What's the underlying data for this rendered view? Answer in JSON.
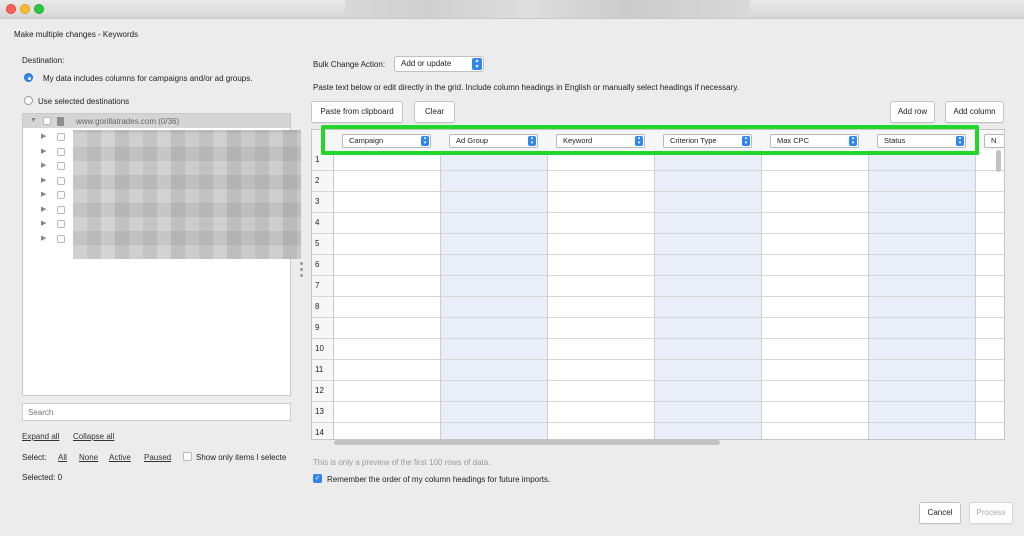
{
  "window": {
    "dialog_title": "Make multiple changes - Keywords"
  },
  "destination": {
    "heading": "Destination:",
    "option_data_label": "My data includes columns for campaigns and/or ad groups.",
    "option_selected_label": "Use selected destinations",
    "tree_root": "www.gorillatrades.com (0/36)",
    "search_placeholder": "Search",
    "expand_all": "Expand all",
    "collapse_all": "Collapse all",
    "select_label": "Select:",
    "select_all": "All",
    "select_none": "None",
    "select_active": "Active",
    "select_paused": "Paused",
    "show_only_label": "Show only items I selecte",
    "selected_count": "Selected: 0"
  },
  "bulk": {
    "action_label": "Bulk Change Action:",
    "action_value": "Add or update",
    "instructions": "Paste text below or edit directly in the grid. Include column headings in English or manually select headings if necessary.",
    "paste_button": "Paste from clipboard",
    "clear_button": "Clear",
    "add_row_button": "Add row",
    "add_column_button": "Add column",
    "columns": [
      "Campaign",
      "Ad Group",
      "Keyword",
      "Criterion Type",
      "Max CPC",
      "Status"
    ],
    "next_column_partial": "N",
    "row_numbers": [
      "1",
      "2",
      "3",
      "4",
      "5",
      "6",
      "7",
      "8",
      "9",
      "10",
      "11",
      "12",
      "13",
      "14"
    ],
    "preview_note": "This is only a preview of the first 100 rows of data.",
    "remember_label": "Remember the order of my column headings for future imports.",
    "remember_checked": true
  },
  "footer": {
    "cancel_button": "Cancel",
    "process_button": "Process"
  },
  "colors": {
    "accent": "#2f86ec",
    "highlight": "#22d62a",
    "stripe": "#e9eef8"
  }
}
